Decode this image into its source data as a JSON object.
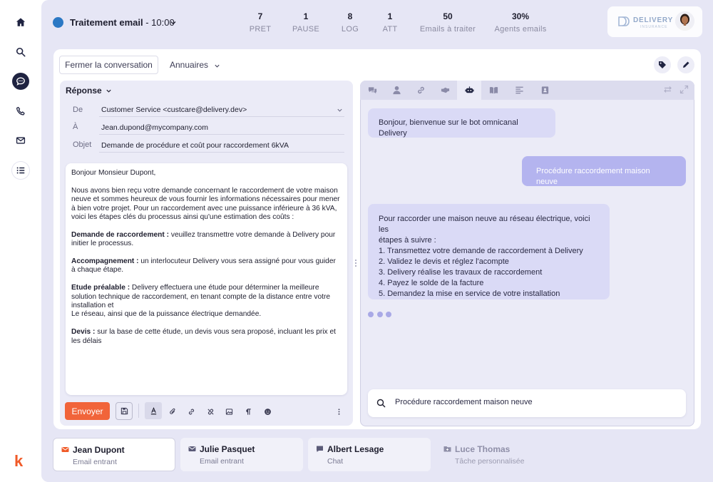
{
  "sidebar": {
    "items": [
      {
        "icon": "home-icon"
      },
      {
        "icon": "search-icon"
      },
      {
        "icon": "chat-icon",
        "active": true
      },
      {
        "icon": "phone-icon"
      },
      {
        "icon": "mail-icon"
      },
      {
        "icon": "list-icon"
      }
    ],
    "logo": "k"
  },
  "topbar": {
    "title_bold": "Traitement email",
    "title_time": " - 10:00",
    "status_color": "#2b78c4",
    "stats": [
      {
        "value": "7",
        "label": "PRET"
      },
      {
        "value": "1",
        "label": "PAUSE"
      },
      {
        "value": "8",
        "label": "LOG"
      },
      {
        "value": "1",
        "label": "ATT"
      },
      {
        "value": "50",
        "label": "Emails à traiter"
      },
      {
        "value": "30%",
        "label": "Agents emails"
      }
    ],
    "brand_name": "DELIVERY",
    "brand_sub": "INSURANCE"
  },
  "toolbar": {
    "close_label": "Fermer la conversation",
    "directories_label": "Annuaires"
  },
  "email": {
    "reply_label": "Réponse",
    "from_label": "De",
    "from_value": "Customer Service <custcare@delivery.dev>",
    "to_label": "À",
    "to_value": "Jean.dupond@mycompany.com",
    "subject_label": "Objet",
    "subject_value": "Demande de procédure et coût pour raccordement 6kVA",
    "body": {
      "greeting": "Bonjour Monsieur Dupont,",
      "intro": "Nous avons bien reçu votre demande concernant le raccordement de votre maison neuve et sommes heureux de vous fournir les informations nécessaires pour mener à bien votre projet. Pour un raccordement avec une puissance inférieure à 36 kVA, voici les étapes clés du processus ainsi qu'une estimation des coûts :",
      "s1_title": "Demande de raccordement :",
      "s1_text": " veuillez transmettre votre demande à Delivery pour initier le processus.",
      "s2_title": "Accompagnement :",
      "s2_text": " un interlocuteur Delivery vous sera assigné pour vous guider à chaque étape.",
      "s3_title": "Etude préalable :",
      "s3_text": " Delivery effectuera une étude pour déterminer la meilleure solution technique de raccordement, en tenant compte de la distance entre votre installation et",
      "s3_text2": "Le réseau, ainsi que de la puissance électrique demandée.",
      "s4_title": "Devis :",
      "s4_text": " sur la base de cette étude, un devis vous sera proposé, incluant les prix et les délais"
    },
    "send_label": "Envoyer"
  },
  "chat": {
    "messages": [
      {
        "from": "bot",
        "text": "Bonjour, bienvenue sur le bot omnicanal Delivery"
      },
      {
        "from": "user",
        "text": "Procédure raccordement maison neuve"
      },
      {
        "from": "bot",
        "lines": [
          "Pour raccorder une maison neuve au réseau électrique, voici les",
          "étapes à suivre :",
          "1. Transmettez votre demande de raccordement à Delivery",
          "2. Validez le devis et réglez l'acompte",
          "3. Delivery réalise les travaux de raccordement",
          "4. Payez le solde de la facture",
          "5. Demandez la mise en service de votre installation"
        ]
      }
    ],
    "input_value": "Procédure raccordement maison neuve"
  },
  "conversations": [
    {
      "name": "Jean Dupont",
      "type": "Email entrant",
      "icon": "mail-icon",
      "active": true
    },
    {
      "name": "Julie Pasquet",
      "type": "Email entrant",
      "icon": "mail-icon"
    },
    {
      "name": "Albert Lesage",
      "type": "Chat",
      "icon": "chat-icon"
    },
    {
      "name": "Luce Thomas",
      "type": "Tâche personnalisée",
      "icon": "folder-icon",
      "muted": true
    }
  ],
  "colors": {
    "accent": "#f1643a",
    "sidebar_active": "#1f2341",
    "user_bubble": "#b4b4ef",
    "bot_bubble": "#dadaf6"
  }
}
